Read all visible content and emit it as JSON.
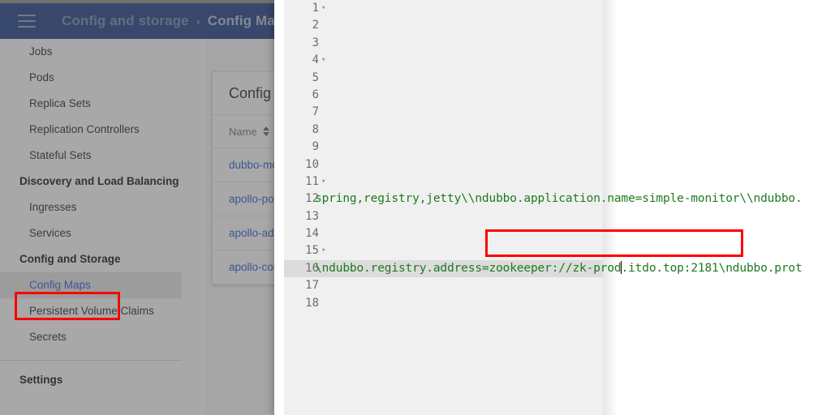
{
  "header": {
    "menu_icon": "hamburger-menu-icon",
    "breadcrumb_parent": "Config and storage",
    "breadcrumb_separator": "›",
    "breadcrumb_current": "Config Maps",
    "accent_color": "#2b4b8e"
  },
  "sidebar": {
    "items": [
      {
        "label": "Jobs",
        "type": "item",
        "active": false
      },
      {
        "label": "Pods",
        "type": "item",
        "active": false
      },
      {
        "label": "Replica Sets",
        "type": "item",
        "active": false
      },
      {
        "label": "Replication Controllers",
        "type": "item",
        "active": false
      },
      {
        "label": "Stateful Sets",
        "type": "item",
        "active": false
      },
      {
        "label": "Discovery and Load Balancing",
        "type": "section",
        "active": false
      },
      {
        "label": "Ingresses",
        "type": "item",
        "active": false
      },
      {
        "label": "Services",
        "type": "item",
        "active": false
      },
      {
        "label": "Config and Storage",
        "type": "section",
        "active": false
      },
      {
        "label": "Config Maps",
        "type": "item",
        "active": true
      },
      {
        "label": "Persistent Volume Claims",
        "type": "item",
        "active": false
      },
      {
        "label": "Secrets",
        "type": "item",
        "active": false
      },
      {
        "label": "Settings",
        "type": "section",
        "active": false
      }
    ]
  },
  "card": {
    "title": "Config Maps",
    "column_name": "Name",
    "sort_icon": "sort-arrows-icon",
    "rows": [
      {
        "name": "dubbo-monitor"
      },
      {
        "name": "apollo-portal"
      },
      {
        "name": "apollo-adminservice"
      },
      {
        "name": "apollo-configservice"
      }
    ]
  },
  "editor": {
    "fold_marker": "▾",
    "active_line": 16,
    "lines": [
      {
        "num": "1",
        "fold": true,
        "text": ""
      },
      {
        "num": "2",
        "fold": false,
        "text": ""
      },
      {
        "num": "3",
        "fold": false,
        "text": ""
      },
      {
        "num": "4",
        "fold": true,
        "text": ""
      },
      {
        "num": "5",
        "fold": false,
        "text": ""
      },
      {
        "num": "6",
        "fold": false,
        "text": ""
      },
      {
        "num": "7",
        "fold": false,
        "text": ""
      },
      {
        "num": "8",
        "fold": false,
        "text": ""
      },
      {
        "num": "9",
        "fold": false,
        "text": ""
      },
      {
        "num": "10",
        "fold": false,
        "text": ""
      },
      {
        "num": "11",
        "fold": true,
        "text": ""
      },
      {
        "num": "12",
        "fold": false,
        "text": "spring,registry,jetty\\\\ndubbo.application.name=simple-monitor\\\\ndubbo."
      },
      {
        "num": "13",
        "fold": false,
        "text": ""
      },
      {
        "num": "14",
        "fold": false,
        "text": ""
      },
      {
        "num": "15",
        "fold": true,
        "text": ""
      },
      {
        "num": "16",
        "fold": false,
        "text": "\\ndubbo.registry.address=zookeeper://zk-prod.itdo.top:2181\\ndubbo.prot"
      },
      {
        "num": "17",
        "fold": false,
        "text": ""
      },
      {
        "num": "18",
        "fold": false,
        "text": ""
      }
    ],
    "code_color": "#1f7a1f",
    "caret_after": "zk-prod"
  },
  "annotations": {
    "highlight_color": "#ff0000",
    "boxes": [
      {
        "target": "Config Maps"
      },
      {
        "target": "s=zookeeper://zk-prod.itdo.top:2181"
      }
    ]
  }
}
